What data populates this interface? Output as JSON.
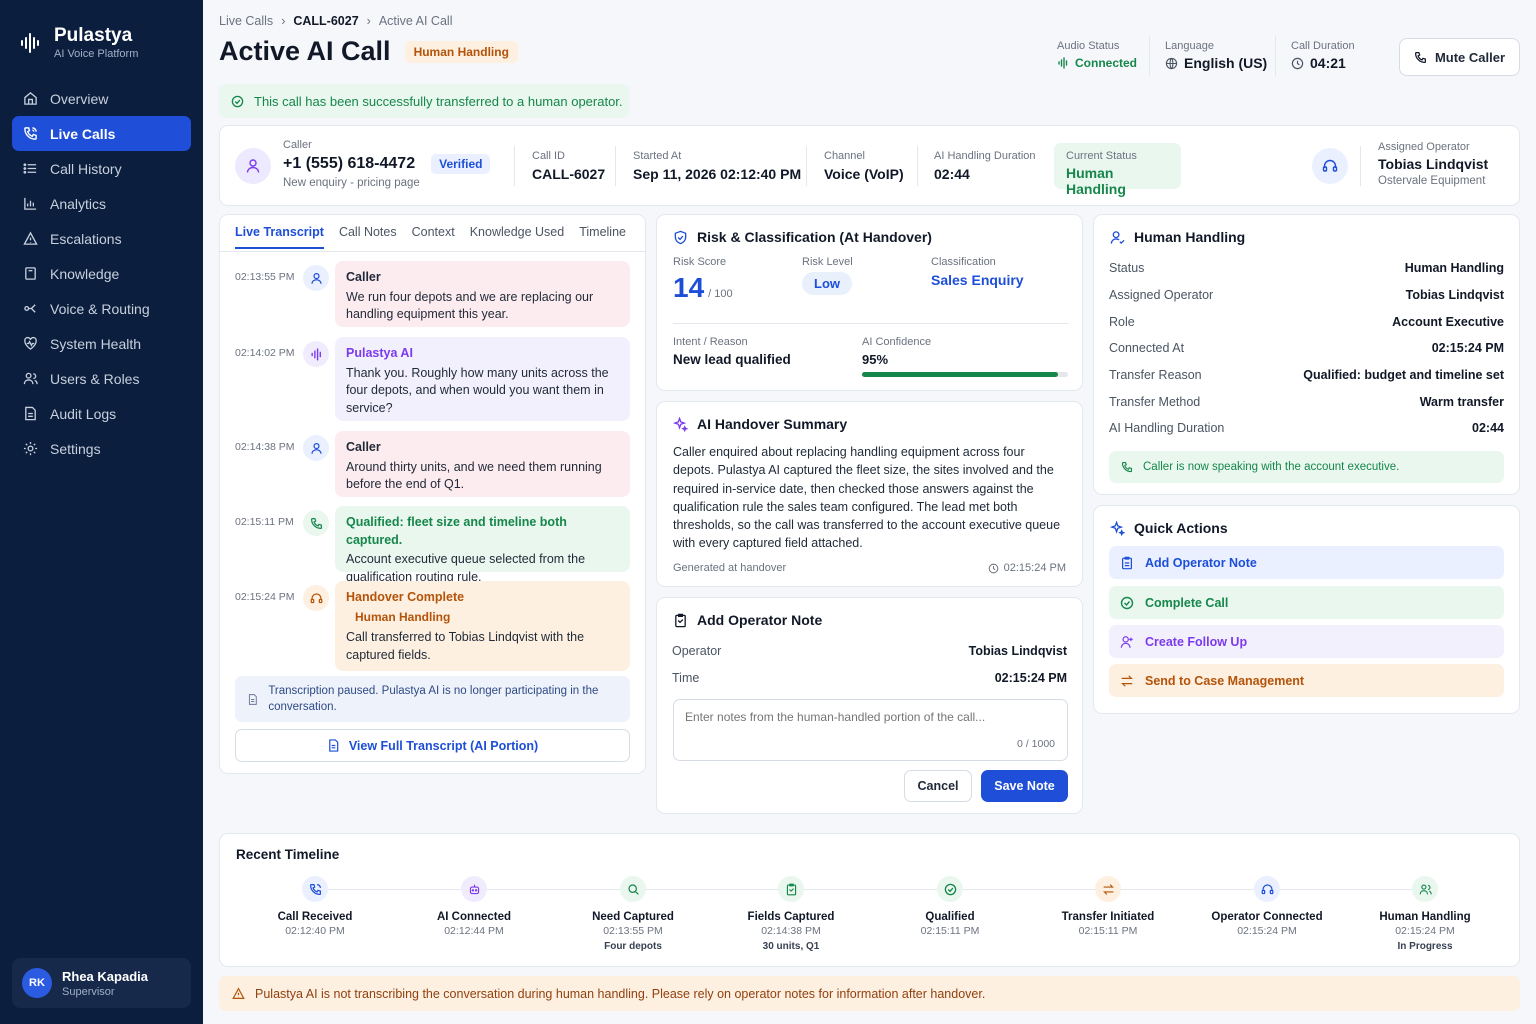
{
  "brand": {
    "name": "Pulastya",
    "subtitle": "AI Voice Platform"
  },
  "nav": [
    {
      "label": "Overview",
      "icon": "home-icon"
    },
    {
      "label": "Live Calls",
      "icon": "phone-call-icon",
      "active": true
    },
    {
      "label": "Call History",
      "icon": "list-icon"
    },
    {
      "label": "Analytics",
      "icon": "bar-chart-icon"
    },
    {
      "label": "Escalations",
      "icon": "alert-triangle-icon"
    },
    {
      "label": "Knowledge",
      "icon": "book-icon"
    },
    {
      "label": "Voice & Routing",
      "icon": "routing-icon"
    },
    {
      "label": "System Health",
      "icon": "heart-pulse-icon"
    },
    {
      "label": "Users & Roles",
      "icon": "users-icon"
    },
    {
      "label": "Audit Logs",
      "icon": "file-log-icon"
    },
    {
      "label": "Settings",
      "icon": "gear-icon"
    }
  ],
  "user": {
    "initials": "RK",
    "name": "Rhea Kapadia",
    "role": "Supervisor"
  },
  "breadcrumb": {
    "root": "Live Calls",
    "call": "CALL-6027",
    "current": "Active AI Call"
  },
  "header": {
    "title": "Active AI Call",
    "badge": "Human Handling",
    "audio_label": "Audio Status",
    "audio_value": "Connected",
    "language_label": "Language",
    "language_value": "English (US)",
    "duration_label": "Call Duration",
    "duration_value": "04:21",
    "mute_label": "Mute Caller"
  },
  "alert_success": "This call has been successfully transferred to a human operator.",
  "caller": {
    "label": "Caller",
    "phone": "+1 (555) 618-4472",
    "verified": "Verified",
    "note": "New enquiry - pricing page",
    "call_id_label": "Call ID",
    "call_id": "CALL-6027",
    "started_label": "Started At",
    "started": "Sep 11, 2026 02:12:40 PM",
    "channel_label": "Channel",
    "channel": "Voice (VoIP)",
    "ai_dur_label": "AI Handling Duration",
    "ai_dur": "02:44",
    "status_label": "Current Status",
    "status": "Human Handling",
    "operator_label": "Assigned Operator",
    "operator": "Tobias Lindqvist",
    "operator_org": "Ostervale Equipment"
  },
  "transcript": {
    "tabs": [
      "Live Transcript",
      "Call Notes",
      "Context",
      "Knowledge Used",
      "Timeline"
    ],
    "messages": [
      {
        "time": "02:13:55 PM",
        "who": "Caller",
        "text": "We run four depots and we are replacing our handling equipment this year."
      },
      {
        "time": "02:14:02 PM",
        "who": "Pulastya AI",
        "text": "Thank you. Roughly how many units across the four depots, and when would you want them in service?"
      },
      {
        "time": "02:14:38 PM",
        "who": "Caller",
        "text": "Around thirty units, and we need them running before the end of Q1."
      },
      {
        "time": "02:15:11 PM",
        "who": "Qualified: fleet size and timeline both captured.",
        "text": "Account executive queue selected from the qualification routing rule."
      },
      {
        "time": "02:15:24 PM",
        "who": "Handover Complete",
        "badge": "Human Handling",
        "text": "Call transferred to Tobias Lindqvist with the captured fields."
      }
    ],
    "paused": "Transcription paused. Pulastya AI is no longer participating in the conversation.",
    "view_full": "View Full Transcript (AI Portion)"
  },
  "risk": {
    "title": "Risk & Classification (At Handover)",
    "score_label": "Risk Score",
    "score": "14",
    "score_max": "/ 100",
    "level_label": "Risk Level",
    "level": "Low",
    "class_label": "Classification",
    "class": "Sales Enquiry",
    "intent_label": "Intent / Reason",
    "intent": "New lead qualified",
    "conf_label": "AI Confidence",
    "conf": "95%",
    "conf_value": 0.95
  },
  "summary": {
    "title": "AI Handover Summary",
    "text": "Caller enquired about replacing handling equipment across four depots. Pulastya AI captured the fleet size, the sites involved and the required in-service date, then checked those answers against the qualification rule the sales team configured. The lead met both thresholds, so the call was transferred to the account executive queue with every captured field attached.",
    "generated": "Generated at handover",
    "time": "02:15:24 PM"
  },
  "note": {
    "title": "Add Operator Note",
    "operator_label": "Operator",
    "operator": "Tobias Lindqvist",
    "time_label": "Time",
    "time": "02:15:24 PM",
    "placeholder": "Enter notes from the human-handled portion of the call...",
    "counter": "0 / 1000",
    "cancel": "Cancel",
    "save": "Save Note"
  },
  "human": {
    "title": "Human Handling",
    "rows": [
      {
        "k": "Status",
        "v": "Human Handling"
      },
      {
        "k": "Assigned Operator",
        "v": "Tobias Lindqvist"
      },
      {
        "k": "Role",
        "v": "Account Executive"
      },
      {
        "k": "Connected At",
        "v": "02:15:24 PM"
      },
      {
        "k": "Transfer Reason",
        "v": "Qualified: budget and timeline set"
      },
      {
        "k": "Transfer Method",
        "v": "Warm transfer"
      },
      {
        "k": "AI Handling Duration",
        "v": "02:44"
      }
    ],
    "speaking": "Caller is now speaking with the account executive."
  },
  "quick": {
    "title": "Quick Actions",
    "actions": [
      "Add Operator Note",
      "Complete Call",
      "Create Follow Up",
      "Send to Case Management"
    ]
  },
  "timeline": {
    "title": "Recent Timeline",
    "items": [
      {
        "title": "Call Received",
        "time": "02:12:40 PM",
        "sub": ""
      },
      {
        "title": "AI Connected",
        "time": "02:12:44 PM",
        "sub": ""
      },
      {
        "title": "Need Captured",
        "time": "02:13:55 PM",
        "sub": "Four depots"
      },
      {
        "title": "Fields Captured",
        "time": "02:14:38 PM",
        "sub": "30 units, Q1"
      },
      {
        "title": "Qualified",
        "time": "02:15:11 PM",
        "sub": ""
      },
      {
        "title": "Transfer Initiated",
        "time": "02:15:11 PM",
        "sub": ""
      },
      {
        "title": "Operator Connected",
        "time": "02:15:24 PM",
        "sub": ""
      },
      {
        "title": "Human Handling",
        "time": "02:15:24 PM",
        "sub": "In Progress"
      }
    ]
  },
  "warning": "Pulastya AI is not transcribing the conversation during human handling. Please rely on operator notes for information after handover."
}
